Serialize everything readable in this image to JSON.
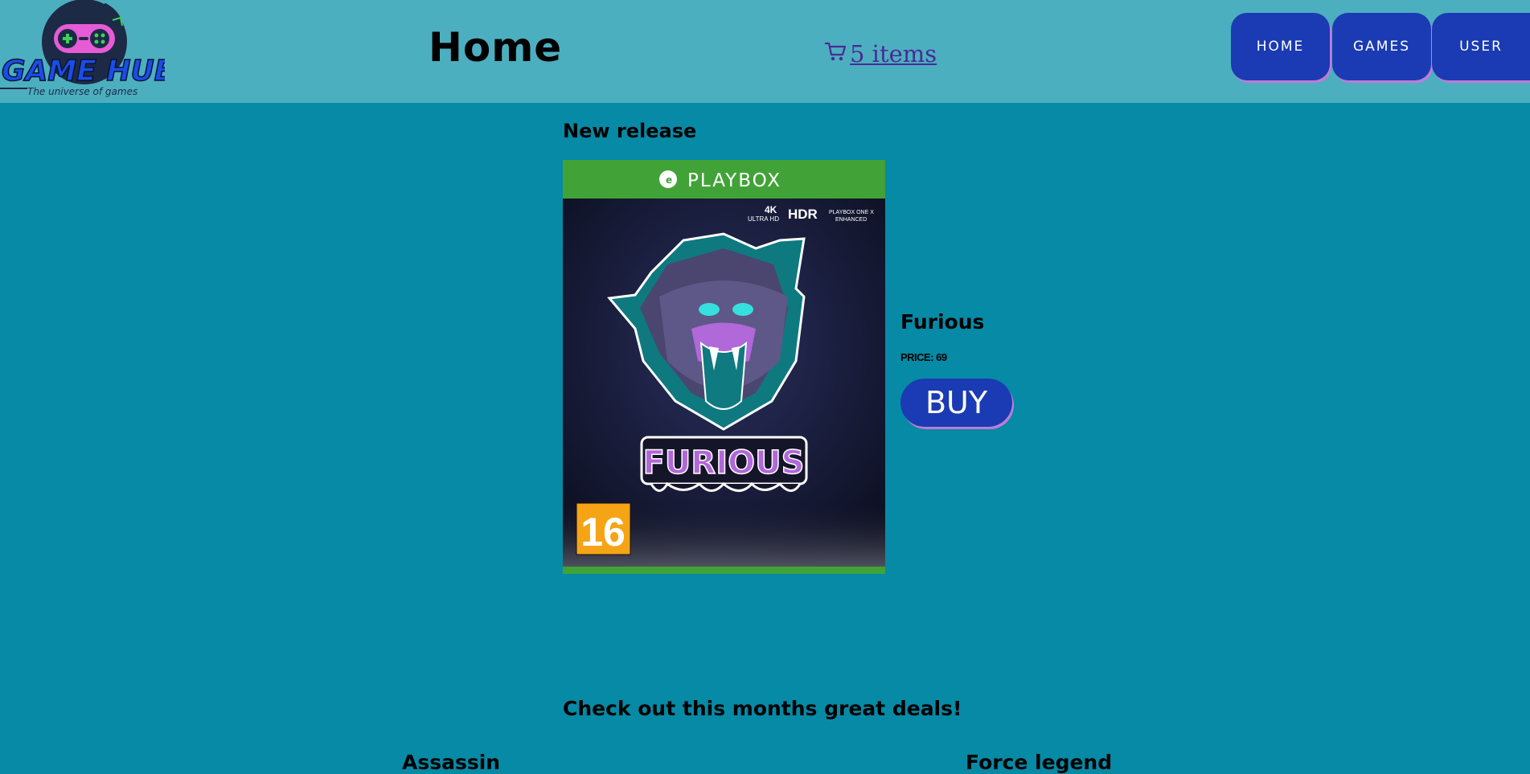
{
  "header": {
    "logo_text": "GAME HUB",
    "logo_tagline": "The universe of games",
    "page_title": "Home",
    "cart_label": " 5 items",
    "nav": [
      {
        "label": "HOME"
      },
      {
        "label": "GAMES"
      },
      {
        "label": "USER"
      }
    ]
  },
  "featured": {
    "section_title": "New release",
    "boxart": {
      "platform": "PLAYBOX",
      "badge_4k": "4K",
      "badge_uhd": "ULTRA HD",
      "badge_hdr": "HDR",
      "badge_enh1": "PLAYBOX ONE X",
      "badge_enh2": "ENHANCED",
      "title": "FURIOUS",
      "age_rating": "16"
    },
    "name": "Furious",
    "price": "PRICE: 69",
    "buy_label": "BUY"
  },
  "deals": {
    "section_title": "Check out this months great deals!",
    "games": [
      {
        "name": "Assassin"
      },
      {
        "name": "Force legend"
      }
    ]
  },
  "colors": {
    "page_bg": "#068aa6",
    "header_bg": "#4cafc0",
    "button_bg": "#1a3bb3",
    "button_shadow": "#c07bd8",
    "boxart_green": "#41a337"
  }
}
